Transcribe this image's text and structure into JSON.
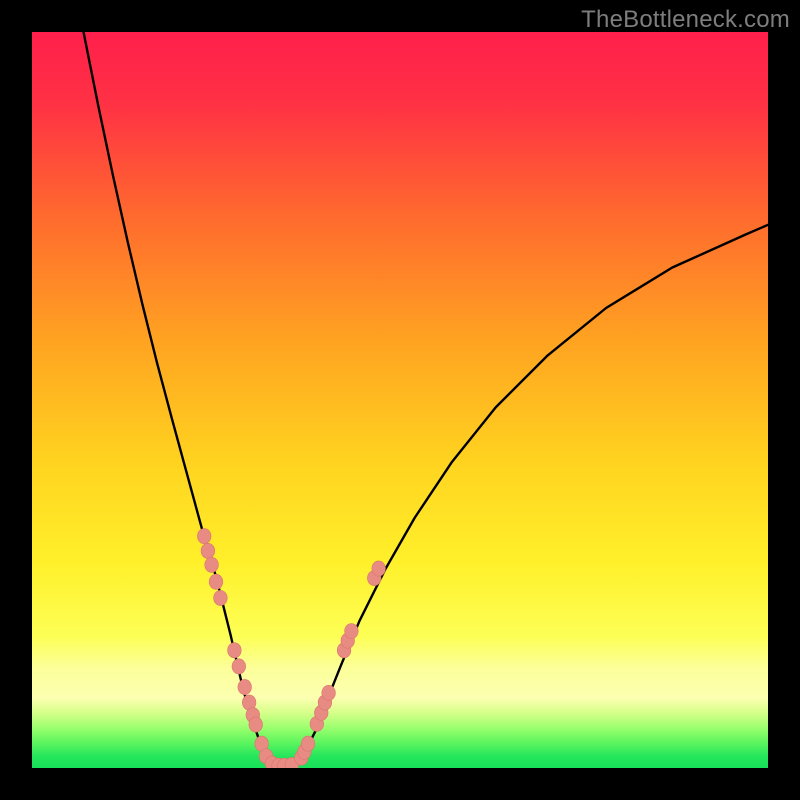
{
  "watermark": "TheBottleneck.com",
  "colors": {
    "bg_black": "#000000",
    "grad_top": "#ff1f4b",
    "grad_mid1": "#ff6a2e",
    "grad_mid2": "#ffd21f",
    "grad_band_light": "#fcff9a",
    "grad_green_light": "#7eff5e",
    "grad_green": "#18e25a",
    "curve": "#000000",
    "marker_fill": "#e88b83",
    "marker_stroke": "#d9756e"
  },
  "chart_data": {
    "type": "line",
    "title": "",
    "xlabel": "",
    "ylabel": "",
    "xlim": [
      0,
      100
    ],
    "ylim": [
      0,
      100
    ],
    "series": [
      {
        "name": "left-branch",
        "x": [
          7,
          9,
          11,
          13,
          15,
          17,
          19,
          20.5,
          22,
          23.5,
          25,
          26,
          27,
          27.8,
          28.5,
          29.2,
          30,
          30.8,
          31.4,
          32
        ],
        "y": [
          100,
          90,
          80.5,
          71.5,
          63,
          55,
          47.5,
          42,
          36.5,
          31,
          26,
          22,
          18,
          14.5,
          11.5,
          8.8,
          6.3,
          4,
          2,
          0.3
        ]
      },
      {
        "name": "valley-floor",
        "x": [
          32,
          33,
          34,
          35,
          36
        ],
        "y": [
          0.3,
          0.1,
          0.1,
          0.1,
          0.3
        ]
      },
      {
        "name": "right-branch",
        "x": [
          36,
          37,
          38.5,
          40,
          42,
          44.5,
          48,
          52,
          57,
          63,
          70,
          78,
          87,
          97,
          100
        ],
        "y": [
          0.3,
          2,
          5,
          9,
          14,
          20,
          27,
          34,
          41.5,
          49,
          56,
          62.5,
          68,
          72.5,
          73.8
        ]
      }
    ],
    "markers": {
      "name": "sample-points",
      "points": [
        {
          "x": 23.4,
          "y": 31.5
        },
        {
          "x": 23.9,
          "y": 29.5
        },
        {
          "x": 24.4,
          "y": 27.6
        },
        {
          "x": 25.0,
          "y": 25.3
        },
        {
          "x": 25.6,
          "y": 23.1
        },
        {
          "x": 27.5,
          "y": 16.0
        },
        {
          "x": 28.1,
          "y": 13.8
        },
        {
          "x": 28.9,
          "y": 11.0
        },
        {
          "x": 29.5,
          "y": 8.9
        },
        {
          "x": 30.0,
          "y": 7.2
        },
        {
          "x": 30.4,
          "y": 5.9
        },
        {
          "x": 31.2,
          "y": 3.3
        },
        {
          "x": 31.8,
          "y": 1.6
        },
        {
          "x": 32.6,
          "y": 0.6
        },
        {
          "x": 33.5,
          "y": 0.3
        },
        {
          "x": 34.3,
          "y": 0.3
        },
        {
          "x": 35.3,
          "y": 0.4
        },
        {
          "x": 36.6,
          "y": 1.4
        },
        {
          "x": 37.0,
          "y": 2.2
        },
        {
          "x": 37.5,
          "y": 3.3
        },
        {
          "x": 38.7,
          "y": 6.0
        },
        {
          "x": 39.3,
          "y": 7.5
        },
        {
          "x": 39.8,
          "y": 8.9
        },
        {
          "x": 40.3,
          "y": 10.2
        },
        {
          "x": 42.4,
          "y": 16.0
        },
        {
          "x": 42.9,
          "y": 17.3
        },
        {
          "x": 43.4,
          "y": 18.6
        },
        {
          "x": 46.5,
          "y": 25.8
        },
        {
          "x": 47.1,
          "y": 27.1
        }
      ]
    }
  }
}
